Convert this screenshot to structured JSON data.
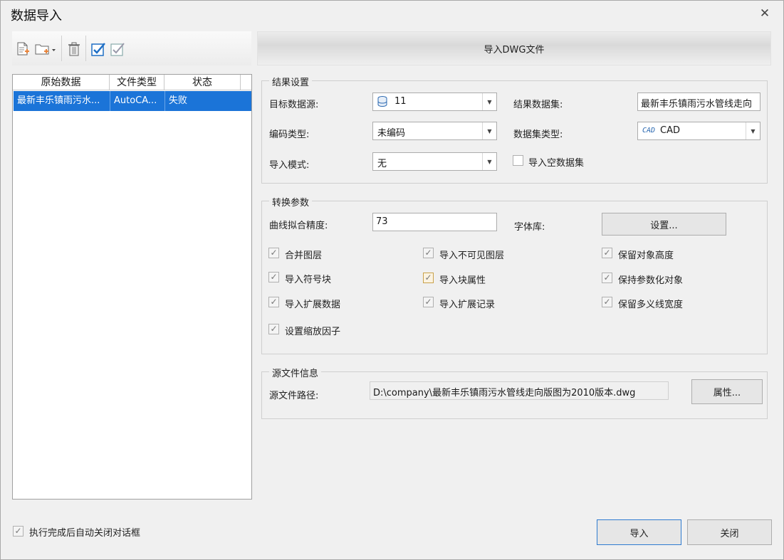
{
  "window": {
    "title": "数据导入",
    "close_glyph": "✕"
  },
  "toolbar": {
    "icons": [
      "new-file-icon",
      "add-folder-icon",
      "delete-icon",
      "select-all-icon",
      "invert-select-icon"
    ]
  },
  "header": {
    "banner_label": "导入DWG文件"
  },
  "file_list": {
    "columns": [
      "原始数据",
      "文件类型",
      "状态"
    ],
    "rows": [
      {
        "name": "最新丰乐镇雨污水...",
        "type": "AutoCA...",
        "status": "失败"
      }
    ]
  },
  "result_settings": {
    "title": "结果设置",
    "target_source_label": "目标数据源:",
    "target_source_value": "11",
    "result_dataset_label": "结果数据集:",
    "result_dataset_value": "最新丰乐镇雨污水管线走向",
    "encoding_label": "编码类型:",
    "encoding_value": "未编码",
    "dataset_type_label": "数据集类型:",
    "dataset_type_badge": "CAD",
    "dataset_type_value": "CAD",
    "import_mode_label": "导入模式:",
    "import_mode_value": "无",
    "import_empty_label": "导入空数据集",
    "import_empty_checked": false
  },
  "conversion": {
    "title": "转换参数",
    "curve_precision_label": "曲线拟合精度:",
    "curve_precision_value": "73",
    "font_lib_label": "字体库:",
    "settings_button": "设置...",
    "options": [
      {
        "label": "合并图层",
        "checked": true
      },
      {
        "label": "导入不可见图层",
        "checked": true
      },
      {
        "label": "保留对象高度",
        "checked": true
      },
      {
        "label": "导入符号块",
        "checked": true
      },
      {
        "label": "导入块属性",
        "checked": true
      },
      {
        "label": "保持参数化对象",
        "checked": true
      },
      {
        "label": "导入扩展数据",
        "checked": true
      },
      {
        "label": "导入扩展记录",
        "checked": true
      },
      {
        "label": "保留多义线宽度",
        "checked": true
      },
      {
        "label": "设置缩放因子",
        "checked": true
      }
    ]
  },
  "source_info": {
    "title": "源文件信息",
    "path_label": "源文件路径:",
    "path_value": "D:\\company\\最新丰乐镇雨污水管线走向版图为2010版本.dwg",
    "properties_button": "属性..."
  },
  "footer": {
    "auto_close_label": "执行完成后自动关闭对话框",
    "auto_close_checked": true,
    "import_button": "导入",
    "close_button": "关闭"
  },
  "colors": {
    "selection": "#1b74d8",
    "icon_blue": "#1f6fc5",
    "icon_orange": "#e8833a"
  }
}
